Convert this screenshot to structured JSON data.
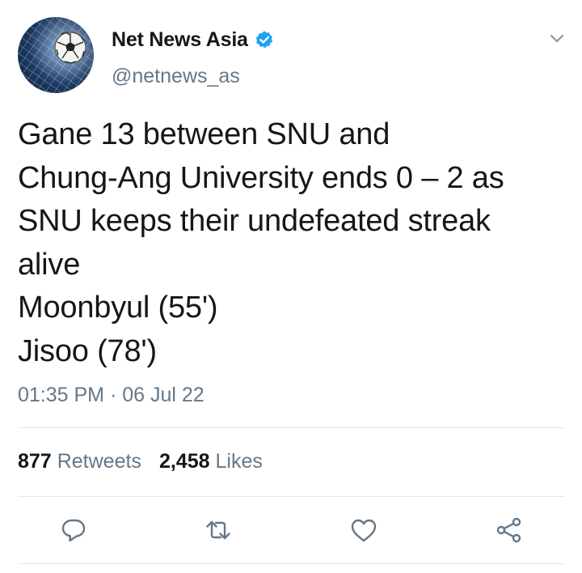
{
  "author": {
    "display_name": "Net News Asia",
    "handle": "@netnews_as",
    "verified_icon": "verified-badge-icon",
    "avatar_icon": "soccer-ball-net-avatar"
  },
  "tweet": {
    "lines": [
      "Gane 13 between SNU and",
      "Chung-Ang University ends 0 – 2 as",
      "SNU keeps their undefeated streak",
      "alive",
      "Moonbyul (55')",
      "Jisoo (78')"
    ],
    "timestamp": "01:35 PM · 06 Jul 22"
  },
  "stats": {
    "retweets_count": "877",
    "retweets_label": "Retweets",
    "likes_count": "2,458",
    "likes_label": "Likes"
  },
  "actions": {
    "reply_icon": "reply-icon",
    "retweet_icon": "retweet-icon",
    "like_icon": "heart-icon",
    "share_icon": "share-icon"
  },
  "colors": {
    "text": "#14171a",
    "secondary": "#657786",
    "verified": "#1da1f2",
    "divider": "#e1e8ed"
  }
}
